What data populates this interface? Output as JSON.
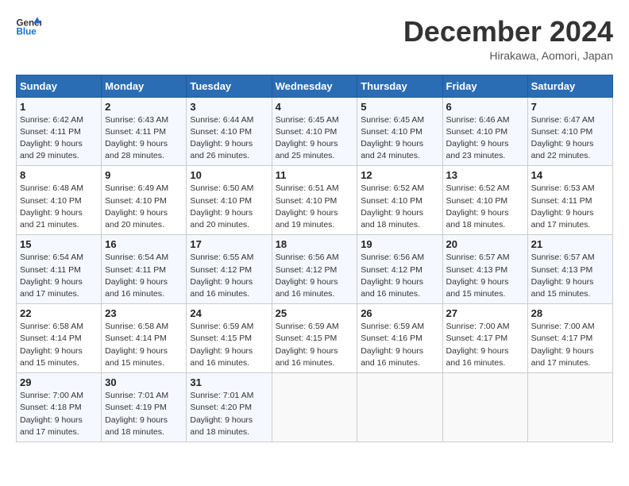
{
  "header": {
    "logo_line1": "General",
    "logo_line2": "Blue",
    "month_title": "December 2024",
    "subtitle": "Hirakawa, Aomori, Japan"
  },
  "weekdays": [
    "Sunday",
    "Monday",
    "Tuesday",
    "Wednesday",
    "Thursday",
    "Friday",
    "Saturday"
  ],
  "weeks": [
    [
      {
        "day": "1",
        "info": "Sunrise: 6:42 AM\nSunset: 4:11 PM\nDaylight: 9 hours\nand 29 minutes."
      },
      {
        "day": "2",
        "info": "Sunrise: 6:43 AM\nSunset: 4:11 PM\nDaylight: 9 hours\nand 28 minutes."
      },
      {
        "day": "3",
        "info": "Sunrise: 6:44 AM\nSunset: 4:10 PM\nDaylight: 9 hours\nand 26 minutes."
      },
      {
        "day": "4",
        "info": "Sunrise: 6:45 AM\nSunset: 4:10 PM\nDaylight: 9 hours\nand 25 minutes."
      },
      {
        "day": "5",
        "info": "Sunrise: 6:45 AM\nSunset: 4:10 PM\nDaylight: 9 hours\nand 24 minutes."
      },
      {
        "day": "6",
        "info": "Sunrise: 6:46 AM\nSunset: 4:10 PM\nDaylight: 9 hours\nand 23 minutes."
      },
      {
        "day": "7",
        "info": "Sunrise: 6:47 AM\nSunset: 4:10 PM\nDaylight: 9 hours\nand 22 minutes."
      }
    ],
    [
      {
        "day": "8",
        "info": "Sunrise: 6:48 AM\nSunset: 4:10 PM\nDaylight: 9 hours\nand 21 minutes."
      },
      {
        "day": "9",
        "info": "Sunrise: 6:49 AM\nSunset: 4:10 PM\nDaylight: 9 hours\nand 20 minutes."
      },
      {
        "day": "10",
        "info": "Sunrise: 6:50 AM\nSunset: 4:10 PM\nDaylight: 9 hours\nand 20 minutes."
      },
      {
        "day": "11",
        "info": "Sunrise: 6:51 AM\nSunset: 4:10 PM\nDaylight: 9 hours\nand 19 minutes."
      },
      {
        "day": "12",
        "info": "Sunrise: 6:52 AM\nSunset: 4:10 PM\nDaylight: 9 hours\nand 18 minutes."
      },
      {
        "day": "13",
        "info": "Sunrise: 6:52 AM\nSunset: 4:10 PM\nDaylight: 9 hours\nand 18 minutes."
      },
      {
        "day": "14",
        "info": "Sunrise: 6:53 AM\nSunset: 4:11 PM\nDaylight: 9 hours\nand 17 minutes."
      }
    ],
    [
      {
        "day": "15",
        "info": "Sunrise: 6:54 AM\nSunset: 4:11 PM\nDaylight: 9 hours\nand 17 minutes."
      },
      {
        "day": "16",
        "info": "Sunrise: 6:54 AM\nSunset: 4:11 PM\nDaylight: 9 hours\nand 16 minutes."
      },
      {
        "day": "17",
        "info": "Sunrise: 6:55 AM\nSunset: 4:12 PM\nDaylight: 9 hours\nand 16 minutes."
      },
      {
        "day": "18",
        "info": "Sunrise: 6:56 AM\nSunset: 4:12 PM\nDaylight: 9 hours\nand 16 minutes."
      },
      {
        "day": "19",
        "info": "Sunrise: 6:56 AM\nSunset: 4:12 PM\nDaylight: 9 hours\nand 16 minutes."
      },
      {
        "day": "20",
        "info": "Sunrise: 6:57 AM\nSunset: 4:13 PM\nDaylight: 9 hours\nand 15 minutes."
      },
      {
        "day": "21",
        "info": "Sunrise: 6:57 AM\nSunset: 4:13 PM\nDaylight: 9 hours\nand 15 minutes."
      }
    ],
    [
      {
        "day": "22",
        "info": "Sunrise: 6:58 AM\nSunset: 4:14 PM\nDaylight: 9 hours\nand 15 minutes."
      },
      {
        "day": "23",
        "info": "Sunrise: 6:58 AM\nSunset: 4:14 PM\nDaylight: 9 hours\nand 15 minutes."
      },
      {
        "day": "24",
        "info": "Sunrise: 6:59 AM\nSunset: 4:15 PM\nDaylight: 9 hours\nand 16 minutes."
      },
      {
        "day": "25",
        "info": "Sunrise: 6:59 AM\nSunset: 4:15 PM\nDaylight: 9 hours\nand 16 minutes."
      },
      {
        "day": "26",
        "info": "Sunrise: 6:59 AM\nSunset: 4:16 PM\nDaylight: 9 hours\nand 16 minutes."
      },
      {
        "day": "27",
        "info": "Sunrise: 7:00 AM\nSunset: 4:17 PM\nDaylight: 9 hours\nand 16 minutes."
      },
      {
        "day": "28",
        "info": "Sunrise: 7:00 AM\nSunset: 4:17 PM\nDaylight: 9 hours\nand 17 minutes."
      }
    ],
    [
      {
        "day": "29",
        "info": "Sunrise: 7:00 AM\nSunset: 4:18 PM\nDaylight: 9 hours\nand 17 minutes."
      },
      {
        "day": "30",
        "info": "Sunrise: 7:01 AM\nSunset: 4:19 PM\nDaylight: 9 hours\nand 18 minutes."
      },
      {
        "day": "31",
        "info": "Sunrise: 7:01 AM\nSunset: 4:20 PM\nDaylight: 9 hours\nand 18 minutes."
      },
      {
        "day": "",
        "info": ""
      },
      {
        "day": "",
        "info": ""
      },
      {
        "day": "",
        "info": ""
      },
      {
        "day": "",
        "info": ""
      }
    ]
  ]
}
